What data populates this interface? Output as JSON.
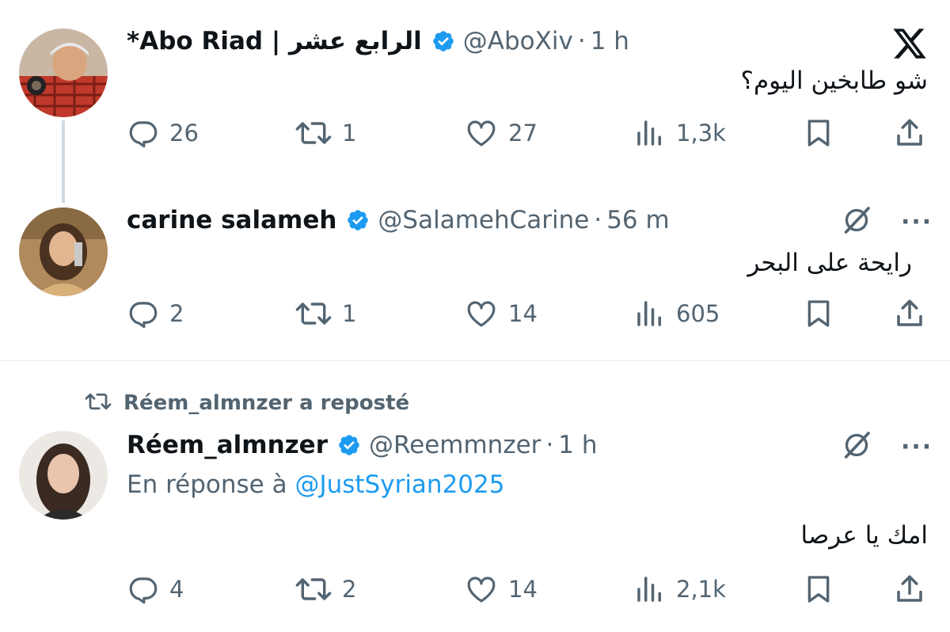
{
  "tweets": [
    {
      "name": "*Abo Riad | الرابع عشر",
      "handle": "@AboXiv",
      "dot": "·",
      "time": "1 h",
      "text": "شو طابخين اليوم؟",
      "replies": "26",
      "reposts": "1",
      "likes": "27",
      "views": "1,3k"
    },
    {
      "name": "carine salameh",
      "handle": "@SalamehCarine",
      "dot": "·",
      "time": "56 m",
      "text": "رايحة على البحر",
      "replies": "2",
      "reposts": "1",
      "likes": "14",
      "views": "605"
    },
    {
      "repost_label": "Réem_almnzer a reposté",
      "name": "Réem_almnzer",
      "handle": "@Reemmnzer",
      "dot": "·",
      "time": "1 h",
      "reply_prefix": "En réponse à",
      "reply_mention": "@JustSyrian2025",
      "text": "امك يا عرصا",
      "replies": "4",
      "reposts": "2",
      "likes": "14",
      "views": "2,1k"
    }
  ],
  "more_label": "···",
  "colors": {
    "verified": "#1d9bf0",
    "muted": "#536471",
    "link": "#1d9bf0",
    "line": "#cfd9de"
  },
  "icons": [
    "x-logo-icon",
    "verified-badge-icon",
    "reply-icon",
    "repost-icon",
    "like-icon",
    "views-icon",
    "bookmark-icon",
    "share-icon",
    "grok-slash-icon",
    "more-icon"
  ]
}
